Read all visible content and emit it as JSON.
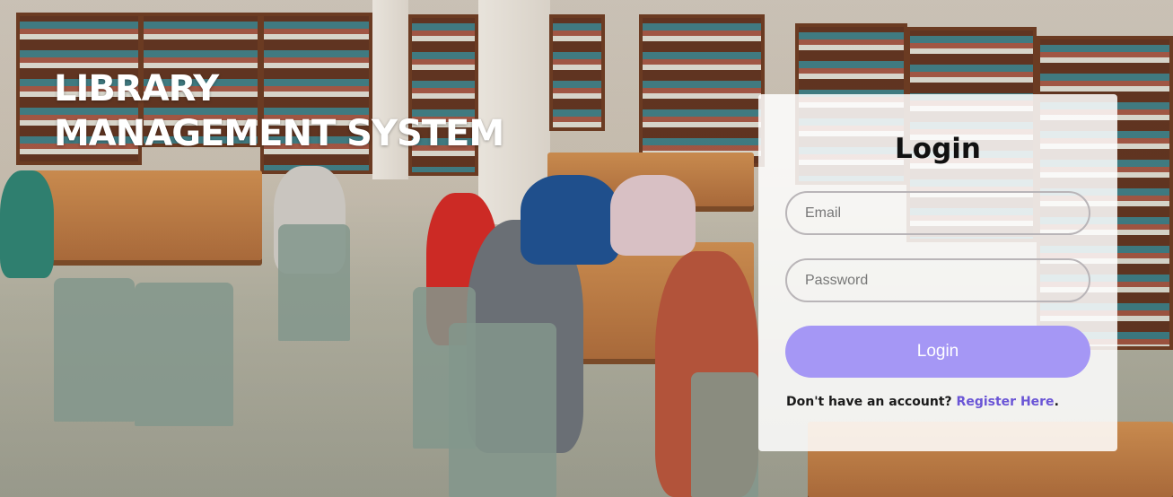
{
  "header": {
    "title_line1": "LIBRARY",
    "title_line2": "MANAGEMENT SYSTEM"
  },
  "login": {
    "title": "Login",
    "email_placeholder": "Email",
    "password_placeholder": "Password",
    "button_label": "Login",
    "register_prompt": "Don't have an account? ",
    "register_link": "Register Here",
    "register_suffix": "."
  },
  "colors": {
    "button_bg": "#a597f5",
    "link": "#6a55d6",
    "card_bg": "rgba(255,255,255,0.86)"
  }
}
